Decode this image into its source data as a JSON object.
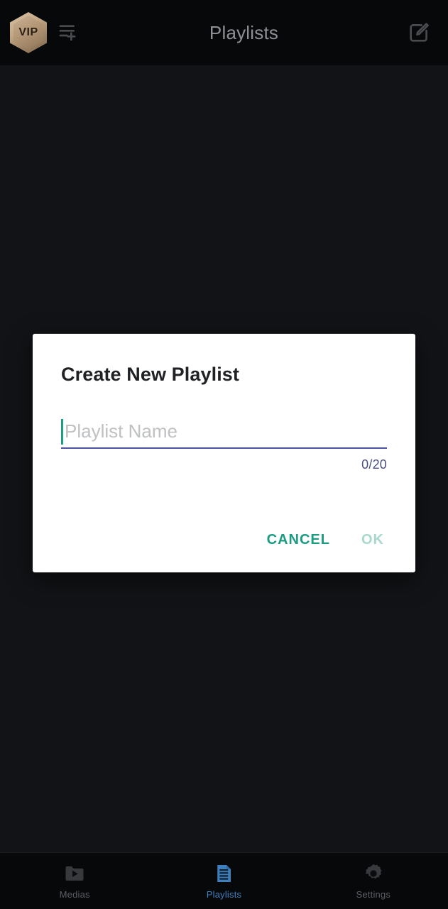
{
  "appbar": {
    "vip_badge_label": "VIP",
    "vip_icon": "vip-hexagon-badge",
    "playlist_add_icon": "playlist-add-icon",
    "title": "Playlists",
    "edit_icon": "compose-edit-icon",
    "background_color": "#070809",
    "title_color": "#8f9095"
  },
  "screen": {
    "background_color": "#121316"
  },
  "dialog": {
    "title": "Create New Playlist",
    "input": {
      "value": "",
      "placeholder": "Playlist Name",
      "underline_color": "#4f53a8",
      "caret_color": "#1f9e85",
      "placeholder_color": "#bfc0c2"
    },
    "char_counter": "0/20",
    "char_counter_color": "#4b4f83",
    "cancel_label": "CANCEL",
    "ok_label": "OK",
    "cancel_color": "#1c9c82",
    "ok_color": "#a9d8cd",
    "background_color": "#ffffff",
    "title_color": "#1f2124"
  },
  "bottom_nav": {
    "active_color": "#3f7fbe",
    "inactive_color": "#5c5e63",
    "items": [
      {
        "label": "Medias",
        "icon": "folder-play-icon",
        "active": false
      },
      {
        "label": "Playlists",
        "icon": "document-lines-icon",
        "active": true
      },
      {
        "label": "Settings",
        "icon": "gear-icon",
        "active": false
      }
    ]
  }
}
